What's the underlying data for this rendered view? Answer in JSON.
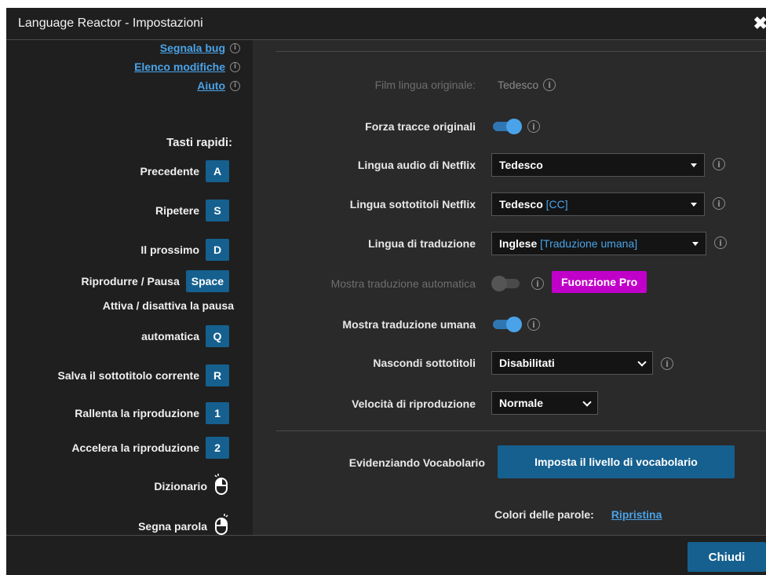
{
  "window": {
    "title": "Language Reactor - Impostazioni",
    "close_glyph": "✖"
  },
  "sidebar": {
    "links": [
      {
        "label": "Segnala bug"
      },
      {
        "label": "Elenco modifiche"
      },
      {
        "label": "Aiuto"
      }
    ],
    "hotkeys_title": "Tasti rapidi:",
    "hotkeys": [
      {
        "label": "Precedente",
        "key": "A"
      },
      {
        "label": "Ripetere",
        "key": "S"
      },
      {
        "label": "Il prossimo",
        "key": "D"
      },
      {
        "label": "Riprodurre / Pausa",
        "key": "Space"
      },
      {
        "label_line1": "Attiva / disattiva la pausa",
        "label_line2": "automatica",
        "key": "Q"
      },
      {
        "label": "Salva il sottotitolo corrente",
        "key": "R"
      },
      {
        "label": "Rallenta la riproduzione",
        "key": "1"
      },
      {
        "label": "Accelera la riproduzione",
        "key": "2"
      },
      {
        "label": "Dizionario",
        "icon": "mouse-left-click-icon"
      },
      {
        "label": "Segna parola",
        "icon": "mouse-right-click-icon"
      }
    ]
  },
  "settings": {
    "original_language": {
      "label": "Film lingua originale:",
      "value": "Tedesco"
    },
    "force_original_tracks": {
      "label": "Forza tracce originali",
      "enabled": true
    },
    "netflix_audio": {
      "label": "Lingua audio di Netflix",
      "value": "Tedesco"
    },
    "netflix_subtitles": {
      "label": "Lingua sottotitoli Netflix",
      "value": "Tedesco",
      "tag": "[CC]"
    },
    "translation_language": {
      "label": "Lingua di traduzione",
      "value": "Inglese",
      "tag": "[Traduzione umana]"
    },
    "auto_translation": {
      "label": "Mostra traduzione automatica",
      "enabled": false,
      "badge": "Fuonzione Pro"
    },
    "human_translation": {
      "label": "Mostra traduzione umana",
      "enabled": true
    },
    "hide_subtitles": {
      "label": "Nascondi sottotitoli",
      "value": "Disabilitati"
    },
    "playback_speed": {
      "label": "Velocità di riproduzione",
      "value": "Normale"
    },
    "vocabulary": {
      "label": "Evidenziando Vocabolario",
      "button": "Imposta il livello di vocabolario"
    },
    "word_colors": {
      "label": "Colori delle parole:",
      "reset": "Ripristina"
    }
  },
  "footer": {
    "close_button": "Chiudi"
  },
  "colors": {
    "accent": "#4aa3e8",
    "button": "#15608f",
    "pro_badge": "#c000c8",
    "panel": "#2a2a2a",
    "sidebar": "#1f1f1f"
  }
}
